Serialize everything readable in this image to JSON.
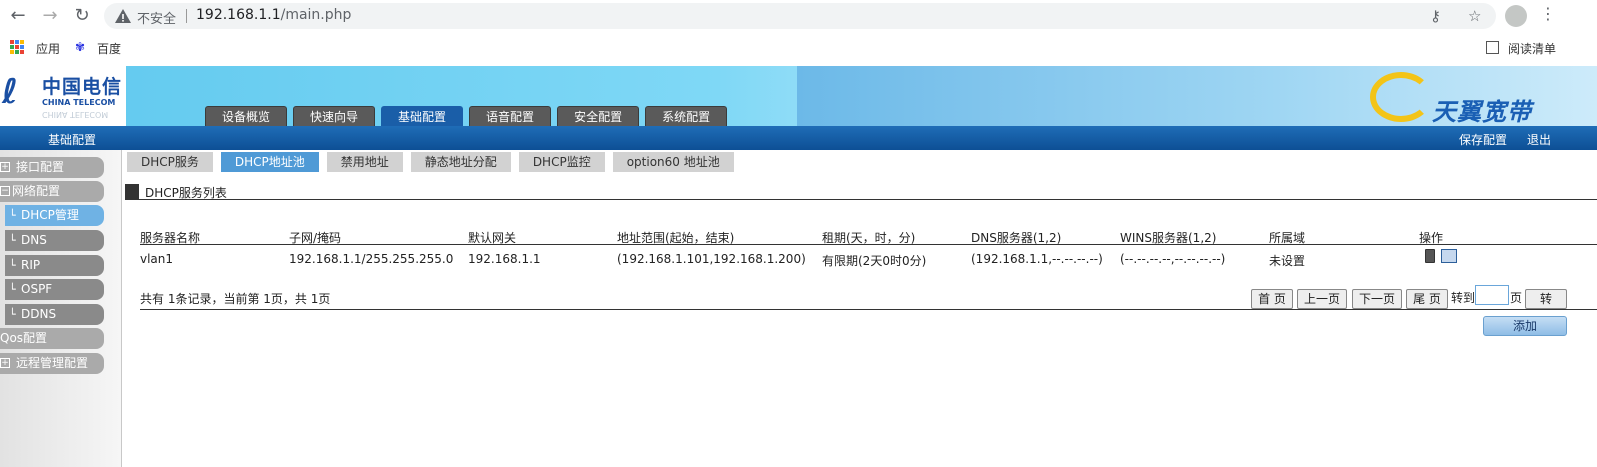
{
  "browser": {
    "back_icon": "back-arrow-icon",
    "forward_icon": "forward-arrow-icon",
    "reload_icon": "reload-icon",
    "insecure_label": "不安全",
    "url_host": "192.168.1.1",
    "url_path": "/main.php",
    "bookmarks": {
      "apps": "应用",
      "baidu": "百度",
      "reading_list": "阅读清单"
    }
  },
  "router": {
    "logo_cn": "中国电信",
    "logo_en": "CHINA TELECOM",
    "brand": "天翼宽带",
    "top_tabs": [
      {
        "label": "设备概览"
      },
      {
        "label": "快速向导"
      },
      {
        "label": "基础配置"
      },
      {
        "label": "语音配置"
      },
      {
        "label": "安全配置"
      },
      {
        "label": "系统配置"
      }
    ],
    "crumb": "基础配置",
    "save_config": "保存配置",
    "logout": "退出"
  },
  "sidebar": {
    "items": [
      {
        "label": "接口配置",
        "sign": "+"
      },
      {
        "label": "网络配置",
        "sign": "−"
      },
      {
        "label": "DHCP管理"
      },
      {
        "label": "DNS"
      },
      {
        "label": "RIP"
      },
      {
        "label": "OSPF"
      },
      {
        "label": "DDNS"
      },
      {
        "label": "Qos配置"
      },
      {
        "label": "远程管理配置",
        "sign": "+"
      }
    ]
  },
  "subtabs": [
    {
      "label": "DHCP服务"
    },
    {
      "label": "DHCP地址池"
    },
    {
      "label": "禁用地址"
    },
    {
      "label": "静态地址分配"
    },
    {
      "label": "DHCP监控"
    },
    {
      "label": "option60 地址池"
    }
  ],
  "section_title": "DHCP服务列表",
  "table": {
    "headers": [
      "服务器名称",
      "子网/掩码",
      "默认网关",
      "地址范围(起始，结束)",
      "租期(天，时，分)",
      "DNS服务器(1,2)",
      "WINS服务器(1,2)",
      "所属域",
      "操作"
    ],
    "rows": [
      [
        "vlan1",
        "192.168.1.1/255.255.255.0",
        "192.168.1.1",
        "(192.168.1.101,192.168.1.200)",
        "有限期(2天0时0分)",
        "(192.168.1.1,--.--.--.--)",
        "(--.--.--.--,--.--.--.--)",
        "未设置"
      ]
    ]
  },
  "pager": {
    "summary": "共有 1条记录，当前第 1页，共 1页",
    "first": "首 页",
    "prev": "上一页",
    "next": "下一页",
    "last": "尾 页",
    "goto_label": "转到",
    "page_unit": "页",
    "go": "转",
    "goto_value": ""
  },
  "add_label": "添加",
  "colors": {
    "header_blue": "#0d4f95",
    "active_tab": "#4f9ad6",
    "logo_blue": "#1a4fa3"
  }
}
